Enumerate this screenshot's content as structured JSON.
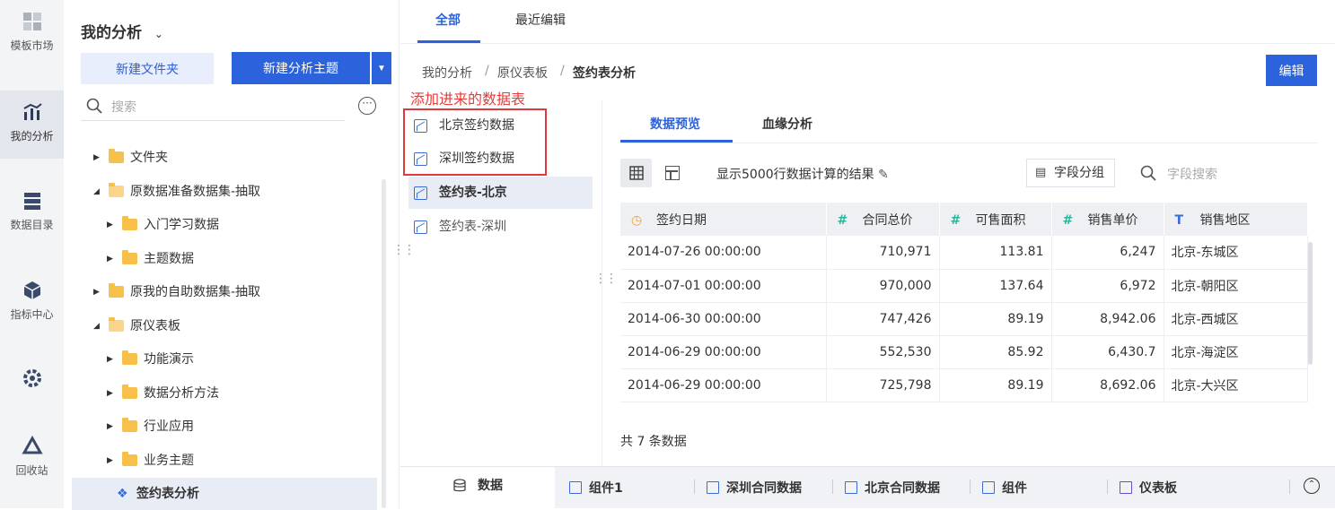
{
  "rail": {
    "items": [
      {
        "label": "模板市场"
      },
      {
        "label": "我的分析"
      },
      {
        "label": "数据目录"
      },
      {
        "label": "指标中心"
      },
      {
        "label": ""
      },
      {
        "label": "回收站"
      }
    ]
  },
  "tree": {
    "title": "我的分析",
    "new_folder": "新建文件夹",
    "new_topic": "新建分析主题",
    "search_placeholder": "搜索",
    "rows": [
      {
        "label": "文件夹"
      },
      {
        "label": "原数据准备数据集-抽取"
      },
      {
        "label": "入门学习数据"
      },
      {
        "label": "主题数据"
      },
      {
        "label": "原我的自助数据集-抽取"
      },
      {
        "label": "原仪表板"
      },
      {
        "label": "功能演示"
      },
      {
        "label": "数据分析方法"
      },
      {
        "label": "行业应用"
      },
      {
        "label": "业务主题"
      },
      {
        "label": "签约表分析"
      }
    ]
  },
  "main": {
    "tabs": {
      "all": "全部",
      "recent": "最近编辑"
    },
    "breadcrumb": {
      "a": "我的分析",
      "b": "原仪表板",
      "c": "签约表分析",
      "sep": "/"
    },
    "edit": "编辑",
    "note": "添加进来的数据表",
    "datasets": [
      {
        "label": "北京签约数据"
      },
      {
        "label": "深圳签约数据"
      },
      {
        "label": "签约表-北京"
      },
      {
        "label": "签约表-深圳"
      }
    ],
    "subtabs": {
      "preview": "数据预览",
      "lineage": "血缘分析"
    },
    "info": "显示5000行数据计算的结果",
    "field_group": "字段分组",
    "field_search": "字段搜索",
    "table": {
      "headers": [
        "签约日期",
        "合同总价",
        "可售面积",
        "销售单价",
        "销售地区"
      ],
      "rows": [
        [
          "2014-07-26 00:00:00",
          "710,971",
          "113.81",
          "6,247",
          "北京-东城区"
        ],
        [
          "2014-07-01 00:00:00",
          "970,000",
          "137.64",
          "6,972",
          "北京-朝阳区"
        ],
        [
          "2014-06-30 00:00:00",
          "747,426",
          "89.19",
          "8,942.06",
          "北京-西城区"
        ],
        [
          "2014-06-29 00:00:00",
          "552,530",
          "85.92",
          "6,430.7",
          "北京-海淀区"
        ],
        [
          "2014-06-29 00:00:00",
          "725,798",
          "89.19",
          "8,692.06",
          "北京-大兴区"
        ]
      ]
    },
    "total": "共 7 条数据",
    "bottom_tabs": {
      "data": "数据",
      "t1": "组件1",
      "t2": "深圳合同数据",
      "t3": "北京合同数据",
      "t4": "组件",
      "t5": "仪表板"
    }
  },
  "colors": {
    "accent": "#2c63dc",
    "annotation": "#e0383d",
    "folder": "#f7c04a"
  }
}
